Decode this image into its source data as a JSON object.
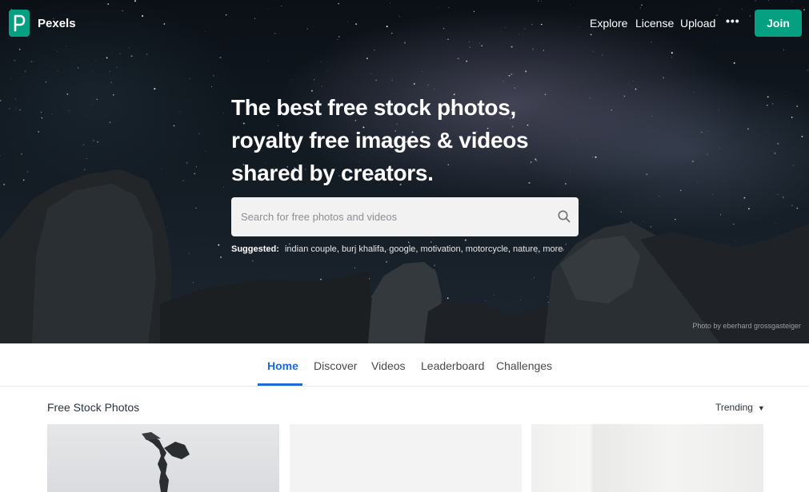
{
  "nav": {
    "logo_text": "Pexels",
    "links": [
      "Explore",
      "License",
      "Upload"
    ],
    "more_label": "•••",
    "join_label": "Join"
  },
  "hero": {
    "title": "The best free stock photos, royalty free images & videos shared by creators.",
    "search_placeholder": "Search for free photos and videos",
    "suggested_label": "Suggested:",
    "suggested": [
      "indian couple",
      "burj khalifa",
      "google",
      "motivation",
      "motorcycle",
      "nature",
      "more"
    ],
    "photo_credit": "Photo by eberhard grossgasteiger"
  },
  "tabs": [
    {
      "label": "Home",
      "active": true
    },
    {
      "label": "Discover",
      "active": false
    },
    {
      "label": "Videos",
      "active": false
    },
    {
      "label": "Leaderboard",
      "active": false
    },
    {
      "label": "Challenges",
      "active": false
    }
  ],
  "content": {
    "section_title": "Free Stock Photos",
    "sort_label": "Trending"
  },
  "colors": {
    "brand": "#05a081",
    "tab_active": "#1f6ad8"
  }
}
